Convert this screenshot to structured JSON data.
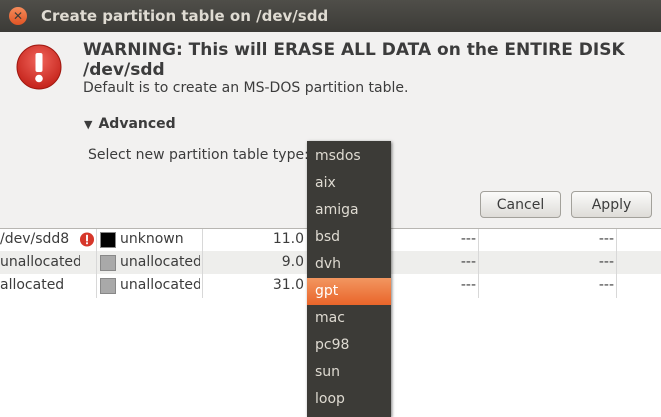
{
  "dialog": {
    "title": "Create partition table on /dev/sdd",
    "headline": "WARNING:  This will ERASE ALL DATA on the ENTIRE DISK /dev/sdd",
    "subtext": "Default is to create an MS-DOS partition table.",
    "advanced_label": "Advanced",
    "type_label": "Select new partition table type:",
    "cancel_label": "Cancel",
    "apply_label": "Apply"
  },
  "menu": {
    "items": [
      "msdos",
      "aix",
      "amiga",
      "bsd",
      "dvh",
      "gpt",
      "mac",
      "pc98",
      "sun",
      "loop"
    ],
    "selected": "gpt"
  },
  "table": {
    "rows": [
      {
        "partition": "/dev/sdd8",
        "filesystem": "unknown",
        "size": "11.0",
        "used": "---",
        "unused": "---",
        "swatch": "#000000",
        "warning": true
      },
      {
        "partition": "unallocated",
        "filesystem": "unallocated",
        "size": "9.0",
        "used": "---",
        "unused": "---",
        "swatch": "#a9a9a9",
        "warning": false
      },
      {
        "partition": "allocated",
        "filesystem": "unallocated",
        "size": "31.0",
        "used": "---",
        "unused": "---",
        "swatch": "#a9a9a9",
        "warning": false
      }
    ]
  },
  "colors": {
    "titlebar": "#3c3b37",
    "accent": "#e9652a",
    "warning_red": "#d6372a"
  },
  "icons": {
    "close": "close-icon",
    "warning": "warning-icon",
    "expander": "triangle-down-icon"
  }
}
